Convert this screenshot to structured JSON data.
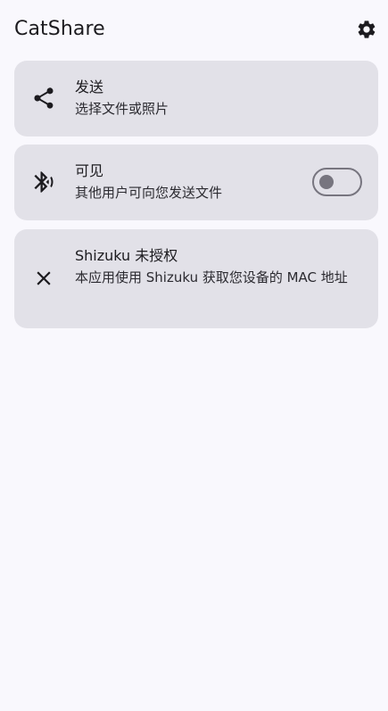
{
  "app": {
    "title": "CatShare"
  },
  "cards": {
    "send": {
      "title": "发送",
      "subtitle": "选择文件或照片",
      "icon": "share-icon"
    },
    "visible": {
      "title": "可见",
      "subtitle": "其他用户可向您发送文件",
      "icon": "bluetooth-searching-icon",
      "switch_on": false
    },
    "shizuku": {
      "title": "Shizuku 未授权",
      "subtitle": "本应用使用 Shizuku 获取您设备的 MAC 地址",
      "icon": "close-icon"
    }
  },
  "colors": {
    "background": "#f9f8fd",
    "card": "#e2e1e8",
    "text": "#1c1b1f",
    "switch_outline": "#77757f"
  }
}
